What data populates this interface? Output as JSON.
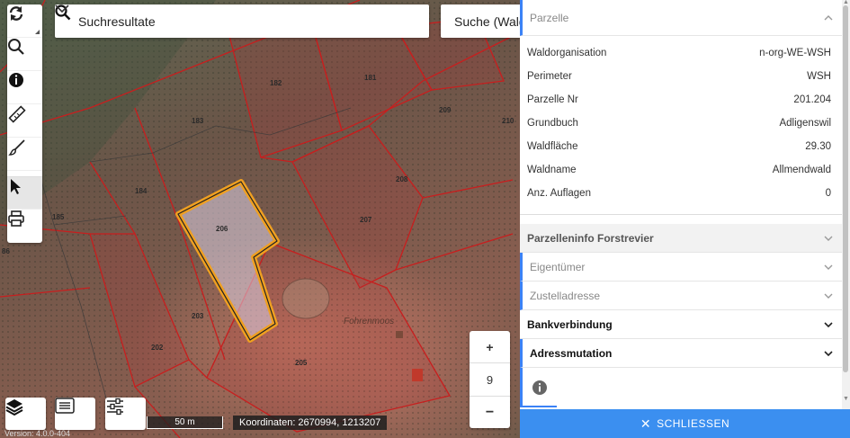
{
  "map": {
    "search": {
      "label": "Suchresultate",
      "label2": "Suche (Wald"
    },
    "tools": [
      {
        "name": "refresh-icon"
      },
      {
        "name": "search-icon"
      },
      {
        "name": "info-icon"
      },
      {
        "name": "ruler-icon"
      },
      {
        "name": "brush-icon"
      },
      {
        "name": "cursor-icon"
      },
      {
        "name": "print-icon"
      }
    ],
    "zoom": {
      "plus": "+",
      "level": "9",
      "minus": "−"
    },
    "scalebar": "50 m",
    "coordinates": "Koordinaten: 2670994, 1213207",
    "version": "Version: 4.0.0-404",
    "parcels": [
      "182",
      "181",
      "209",
      "210",
      "183",
      "208",
      "184",
      "207",
      "185",
      "206",
      "86",
      "203",
      "202",
      "205"
    ],
    "place": "Fohrenmoos",
    "colors": {
      "parcel_outline": "#c81e1e",
      "selection_outline": "#f0a020"
    }
  },
  "panel": {
    "parzelle": {
      "title": "Parzelle",
      "rows": [
        {
          "k": "Waldorganisation",
          "v": "n-org-WE-WSH"
        },
        {
          "k": "Perimeter",
          "v": "WSH"
        },
        {
          "k": "Parzelle Nr",
          "v": "201.204"
        },
        {
          "k": "Grundbuch",
          "v": "Adligenswil"
        },
        {
          "k": "Waldfläche",
          "v": "29.30"
        },
        {
          "k": "Waldname",
          "v": "Allmendwald"
        },
        {
          "k": "Anz. Auflagen",
          "v": "0"
        }
      ]
    },
    "sections": {
      "forstrevier": "Parzelleninfo Forstrevier",
      "eigentuemer": "Eigentümer",
      "zustelladresse": "Zustelladresse",
      "bankverbindung": "Bankverbindung",
      "adressmutation": "Adressmutation"
    },
    "close": "SCHLIESSEN",
    "accent": "#3b82f6"
  }
}
